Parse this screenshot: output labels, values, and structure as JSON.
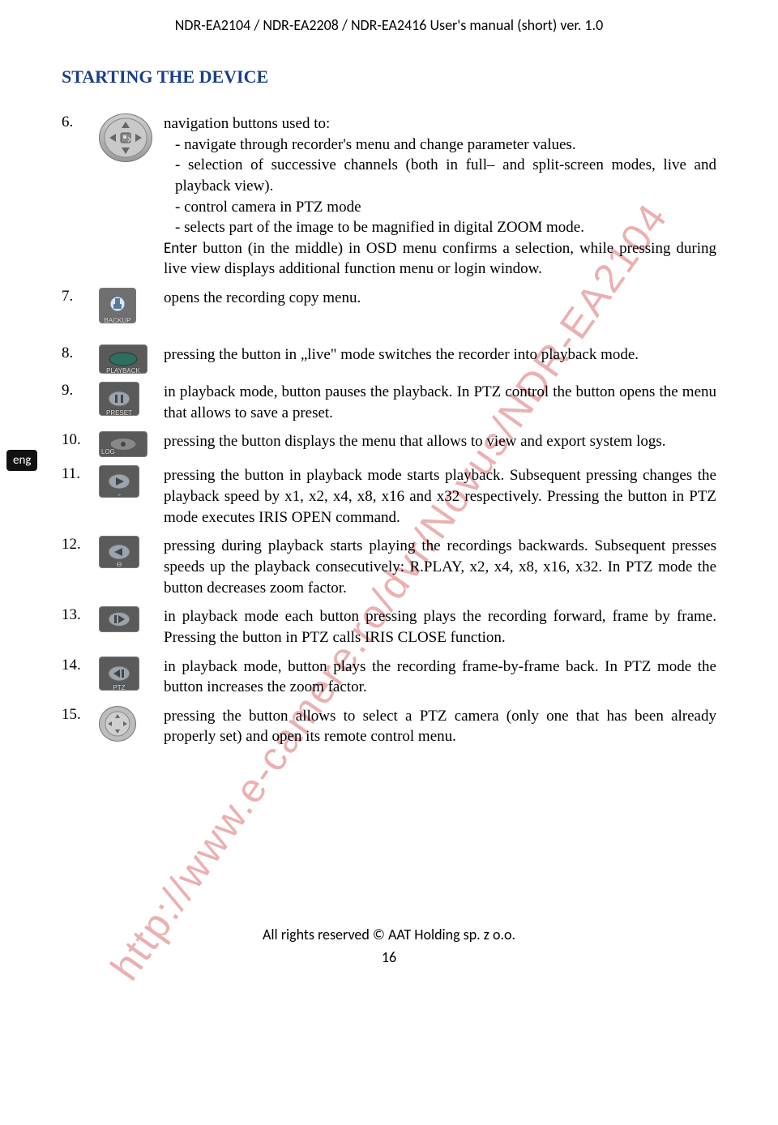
{
  "header": "NDR-EA2104 / NDR-EA2208 / NDR-EA2416 User's manual (short) ver. 1.0",
  "section_title": "STARTING THE DEVICE",
  "lang_tab": "eng",
  "watermark": "http://www.e-camere.ro/dvr/Novus/NDR-EA2104",
  "footer": "All rights reserved © AAT Holding sp. z o.o.",
  "page_number": "16",
  "items": [
    {
      "num": "6.",
      "icon_label": "",
      "lines": [
        "navigation buttons used to:",
        "- navigate through recorder's menu and change parameter values.",
        "- selection of successive channels (both in full– and split-screen modes, live and playback view).",
        "- control camera in PTZ mode",
        "- selects part of the image to be magnified in digital ZOOM mode."
      ],
      "enter_line": "Enter button (in the middle) in OSD menu confirms a selection, while pressing during live view displays additional function menu or login window."
    },
    {
      "num": "7.",
      "icon_label": "BACKUP",
      "text": "opens the recording copy menu."
    },
    {
      "num": "8.",
      "icon_label": "PLAYBACK",
      "text": "pressing the button in „live\" mode switches the recorder into playback mode."
    },
    {
      "num": "9.",
      "icon_label": "PRESET",
      "text": "in playback mode, button pauses the playback. In PTZ control the button opens the menu that allows to save a preset."
    },
    {
      "num": "10.",
      "icon_label": "LOG",
      "text": "pressing the button displays the menu that allows to view and export system logs."
    },
    {
      "num": "11.",
      "icon_label": "",
      "text": "pressing the button in playback mode starts playback. Subsequent pressing changes the playback speed by x1, x2, x4, x8, x16 and x32 respectively. Pressing the button in PTZ mode executes IRIS OPEN command."
    },
    {
      "num": "12.",
      "icon_label": "",
      "text": "pressing during playback starts playing the recordings backwards. Subsequent presses speeds up the playback consecutively: R.PLAY, x2, x4, x8, x16, x32. In PTZ mode the button decreases zoom factor."
    },
    {
      "num": "13.",
      "icon_label": "",
      "text": "in playback mode each button pressing plays the recording forward, frame by frame. Pressing the button in PTZ calls IRIS CLOSE function."
    },
    {
      "num": "14.",
      "icon_label": "PTZ",
      "text": "in playback mode, button plays the recording frame-by-frame back. In PTZ mode the button increases the zoom factor."
    },
    {
      "num": "15.",
      "icon_label": "",
      "text": "pressing the button allows to select a PTZ camera (only one that has been already properly set) and open its remote control menu."
    }
  ]
}
